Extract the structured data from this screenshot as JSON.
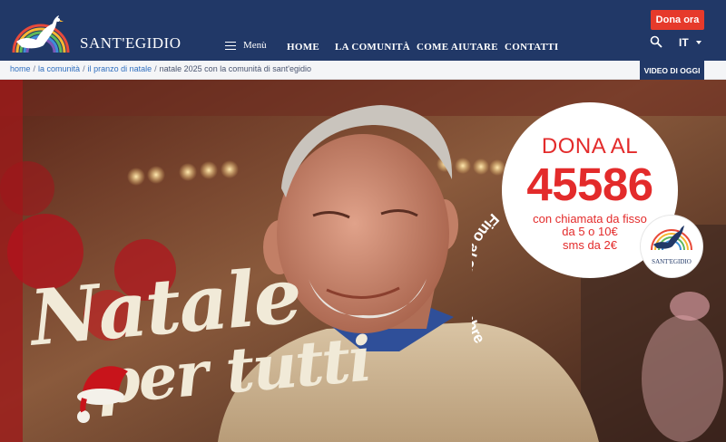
{
  "header": {
    "brand": "SANT'EGIDIO",
    "menu_label": "Menù",
    "nav": [
      {
        "label": "HOME"
      },
      {
        "label": "LA COMUNITÀ"
      },
      {
        "label": "COME AIUTARE"
      },
      {
        "label": "CONTATTI"
      }
    ],
    "donate_label": "Dona ora",
    "language": "IT",
    "search_icon": "search-icon",
    "colors": {
      "bar": "#213867",
      "donate": "#e63a2b"
    }
  },
  "breadcrumb": {
    "items": [
      "home",
      "la comunità",
      "il pranzo di natale"
    ],
    "current": "natale 2025 con la comunità di sant'egidio",
    "video_button": "VIDEO DI OGGI"
  },
  "hero": {
    "donate_line1": "DONA AL",
    "number": "45586",
    "line3": "con chiamata da fisso",
    "line4": "da 5 o 10€",
    "line5": "sms da 2€",
    "arc_text": "Fino al 27 dicembre",
    "mini_logo_text": "SANT'EGIDIO",
    "headline_1": "Natale",
    "headline_2": "per tutti",
    "accent_red": "#e32b2b"
  }
}
